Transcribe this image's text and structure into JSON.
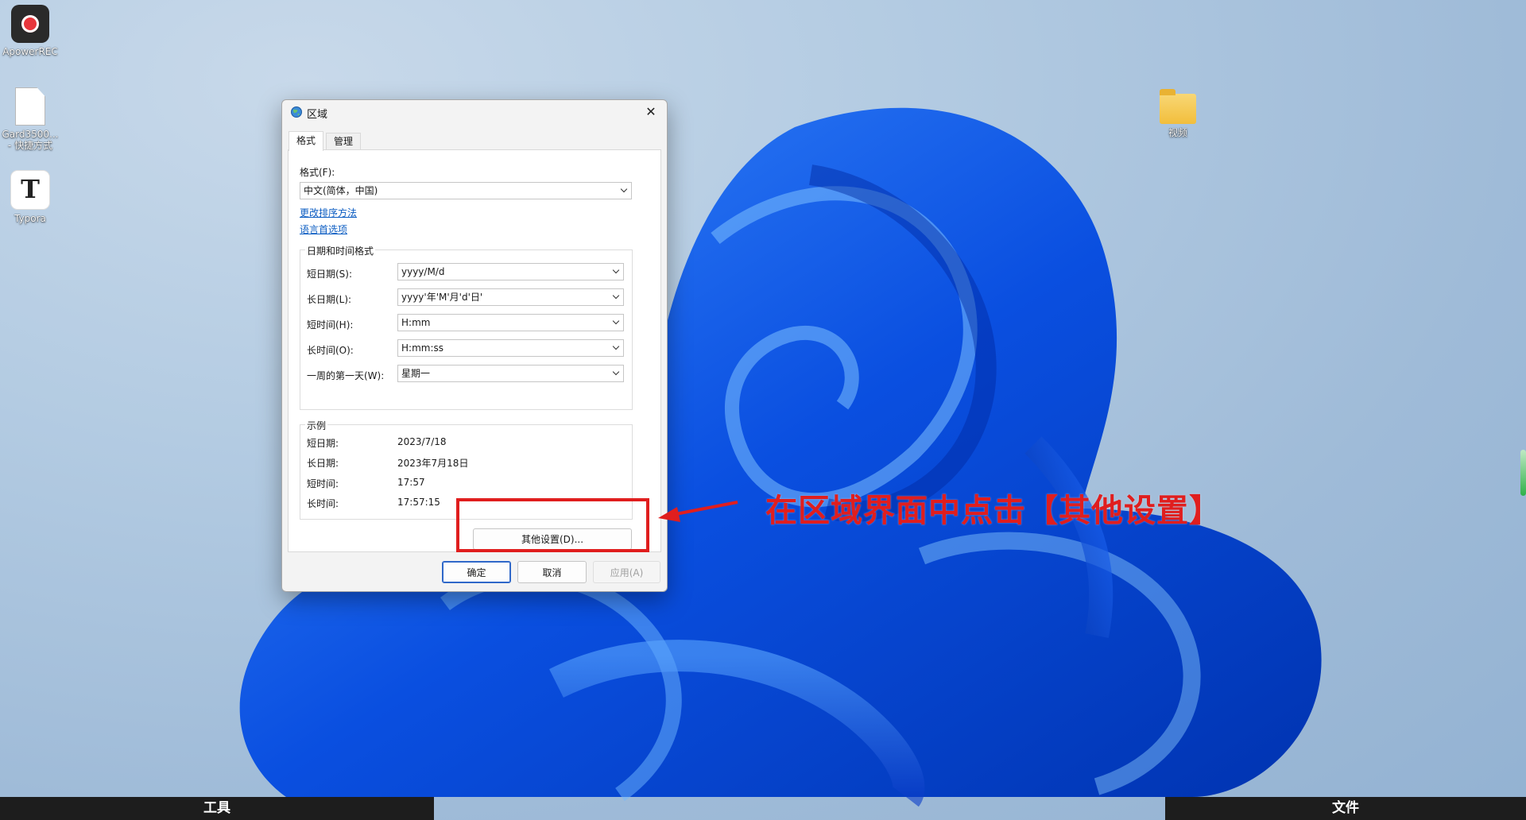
{
  "desktop": {
    "icons": [
      {
        "label": "ApowerREC",
        "icon": "apowerrec-icon"
      },
      {
        "label": "Gard3500...",
        "label2": "- 快捷方式",
        "icon": "shortcut-file-icon"
      },
      {
        "label": "Typora",
        "icon": "typora-icon"
      },
      {
        "label": "视频",
        "icon": "folder-icon"
      }
    ]
  },
  "dialog": {
    "title": "区域",
    "tabs": [
      {
        "label": "格式",
        "active": true
      },
      {
        "label": "管理",
        "active": false
      }
    ],
    "format": {
      "label": "格式(F):",
      "value": "中文(简体，中国)"
    },
    "links": {
      "sort_method": "更改排序方法",
      "language_prefs": "语言首选项"
    },
    "datetime_group": {
      "title": "日期和时间格式",
      "rows": [
        {
          "label": "短日期(S):",
          "value": "yyyy/M/d"
        },
        {
          "label": "长日期(L):",
          "value": "yyyy'年'M'月'd'日'"
        },
        {
          "label": "短时间(H):",
          "value": "H:mm"
        },
        {
          "label": "长时间(O):",
          "value": "H:mm:ss"
        },
        {
          "label": "一周的第一天(W):",
          "value": "星期一"
        }
      ]
    },
    "examples_group": {
      "title": "示例",
      "rows": [
        {
          "label": "短日期:",
          "value": "2023/7/18"
        },
        {
          "label": "长日期:",
          "value": "2023年7月18日"
        },
        {
          "label": "短时间:",
          "value": "17:57"
        },
        {
          "label": "长时间:",
          "value": "17:57:15"
        }
      ]
    },
    "buttons": {
      "additional_settings": "其他设置(D)...",
      "ok": "确定",
      "cancel": "取消",
      "apply": "应用(A)"
    }
  },
  "annotation": {
    "text": "在区域界面中点击【其他设置】",
    "color": "#e01e1e"
  },
  "bottom_bars": {
    "left": "工具",
    "right": "文件"
  }
}
